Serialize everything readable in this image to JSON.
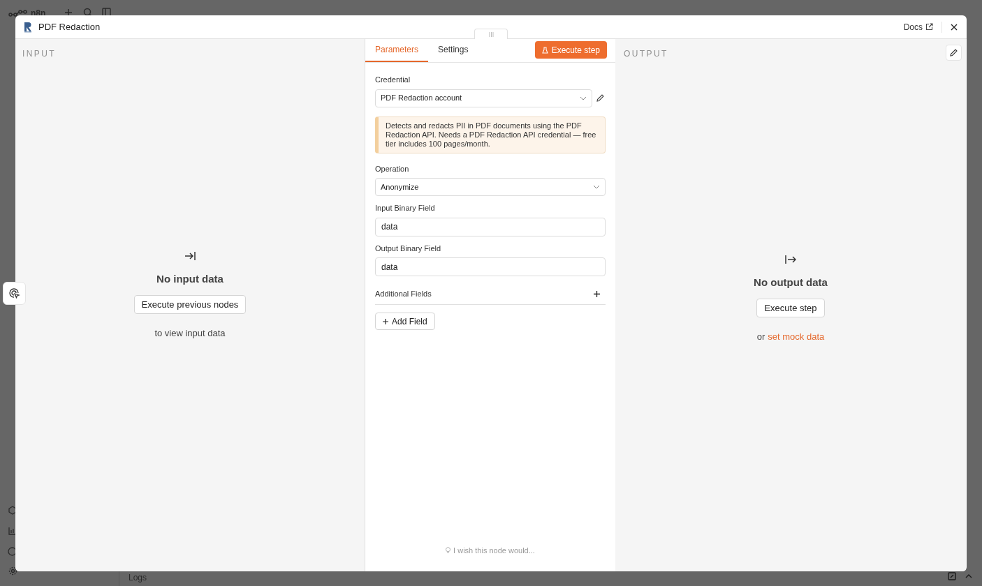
{
  "background": {
    "app_name": "n8n",
    "bottom_panel": {
      "title": "Logs"
    }
  },
  "modal": {
    "title": "PDF Redaction",
    "docs_link": "Docs",
    "input": {
      "heading": "INPUT",
      "empty_title": "No input data",
      "button": "Execute previous nodes",
      "hint": "to view input data"
    },
    "tabs": [
      {
        "label": "Parameters",
        "selected": true
      },
      {
        "label": "Settings",
        "selected": false
      }
    ],
    "execute_button": "Execute step",
    "params": [
      {
        "kind": "select",
        "label": "Credential",
        "value": "PDF Redaction account",
        "editable": true
      },
      {
        "kind": "notice",
        "text": "Detects and redacts PII in PDF documents using the PDF Redaction API. Needs a PDF Redaction API credential — free tier includes 100 pages/month."
      },
      {
        "kind": "select",
        "label": "Operation",
        "value": "Anonymize",
        "editable": false
      },
      {
        "kind": "text",
        "label": "Input Binary Field",
        "value": "data"
      },
      {
        "kind": "text",
        "label": "Output Binary Field",
        "value": "data"
      },
      {
        "kind": "collection",
        "label": "Additional Fields",
        "button": "Add Field"
      }
    ],
    "feedback": "I wish this node would...",
    "output": {
      "heading": "OUTPUT",
      "empty_title": "No output data",
      "button": "Execute step",
      "hint_prefix": "or",
      "hint_link": "set mock data"
    }
  }
}
